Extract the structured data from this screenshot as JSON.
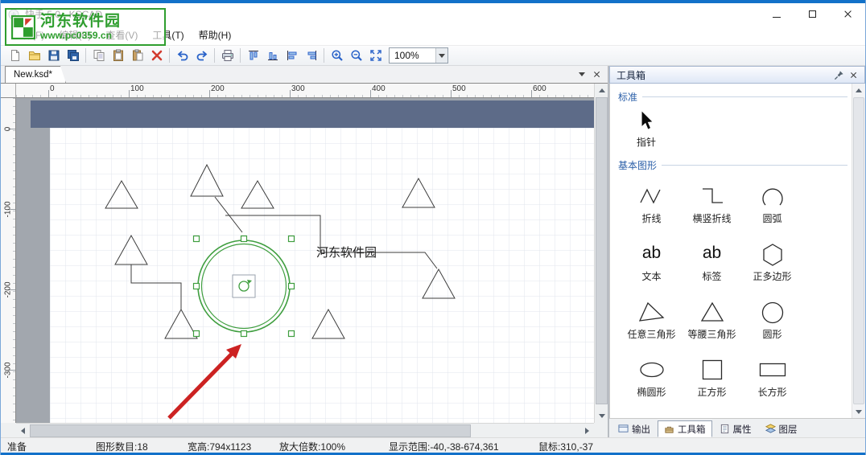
{
  "window": {
    "title": "快手 5.0 - KSCAD"
  },
  "watermark": {
    "line1": "河东软件园",
    "line2": "www.pc0359.cn"
  },
  "menu": {
    "items": [
      "文件(F)",
      "编辑(E)",
      "查看(V)",
      "工具(T)",
      "帮助(H)"
    ]
  },
  "toolbar": {
    "zoom": "100%",
    "icons": [
      "new",
      "open",
      "save",
      "save-all",
      "copy",
      "paste",
      "paste-special",
      "delete",
      "undo",
      "redo",
      "print",
      "align-top",
      "align-bottom",
      "align-left",
      "align-right",
      "zoom-in",
      "zoom-out",
      "zoom-fit"
    ]
  },
  "tabbar": {
    "document": "New.ksd*"
  },
  "rulers": {
    "h": [
      "0",
      "100",
      "200",
      "300",
      "400",
      "500",
      "600"
    ],
    "v": [
      "0",
      "-100",
      "-200",
      "-300"
    ]
  },
  "canvas": {
    "label": "河东软件园"
  },
  "toolbox": {
    "title": "工具箱",
    "sections": [
      {
        "title": "标准",
        "items": [
          {
            "label": "指针",
            "icon": "pointer-icon"
          }
        ]
      },
      {
        "title": "基本图形",
        "items": [
          {
            "label": "折线",
            "icon": "polyline-icon"
          },
          {
            "label": "横竖折线",
            "icon": "hv-polyline-icon"
          },
          {
            "label": "圆弧",
            "icon": "arc-icon"
          },
          {
            "label": "文本",
            "icon": "text-icon",
            "glyph": "ab"
          },
          {
            "label": "标签",
            "icon": "label-icon",
            "glyph": "ab"
          },
          {
            "label": "正多边形",
            "icon": "regular-polygon-icon"
          },
          {
            "label": "任意三角形",
            "icon": "any-triangle-icon"
          },
          {
            "label": "等腰三角形",
            "icon": "isosceles-triangle-icon"
          },
          {
            "label": "圆形",
            "icon": "circle-icon"
          },
          {
            "label": "椭圆形",
            "icon": "ellipse-icon"
          },
          {
            "label": "正方形",
            "icon": "square-icon"
          },
          {
            "label": "长方形",
            "icon": "rectangle-icon"
          }
        ]
      }
    ],
    "bottom_tabs": [
      "输出",
      "工具箱",
      "属性",
      "图层"
    ]
  },
  "statusbar": {
    "ready": "准备",
    "shapes": "图形数目:18",
    "size": "宽高:794x1123",
    "zoom": "放大倍数:100%",
    "range": "显示范围:-40,-38-674,361",
    "mouse": "鼠标:310,-37"
  },
  "colors": {
    "accent_border": "#1271c9",
    "selection_green": "#3f9e3f",
    "arrow_red": "#cc2222",
    "page_band": "#5d6b88",
    "watermark_green": "#2f9e2f"
  }
}
